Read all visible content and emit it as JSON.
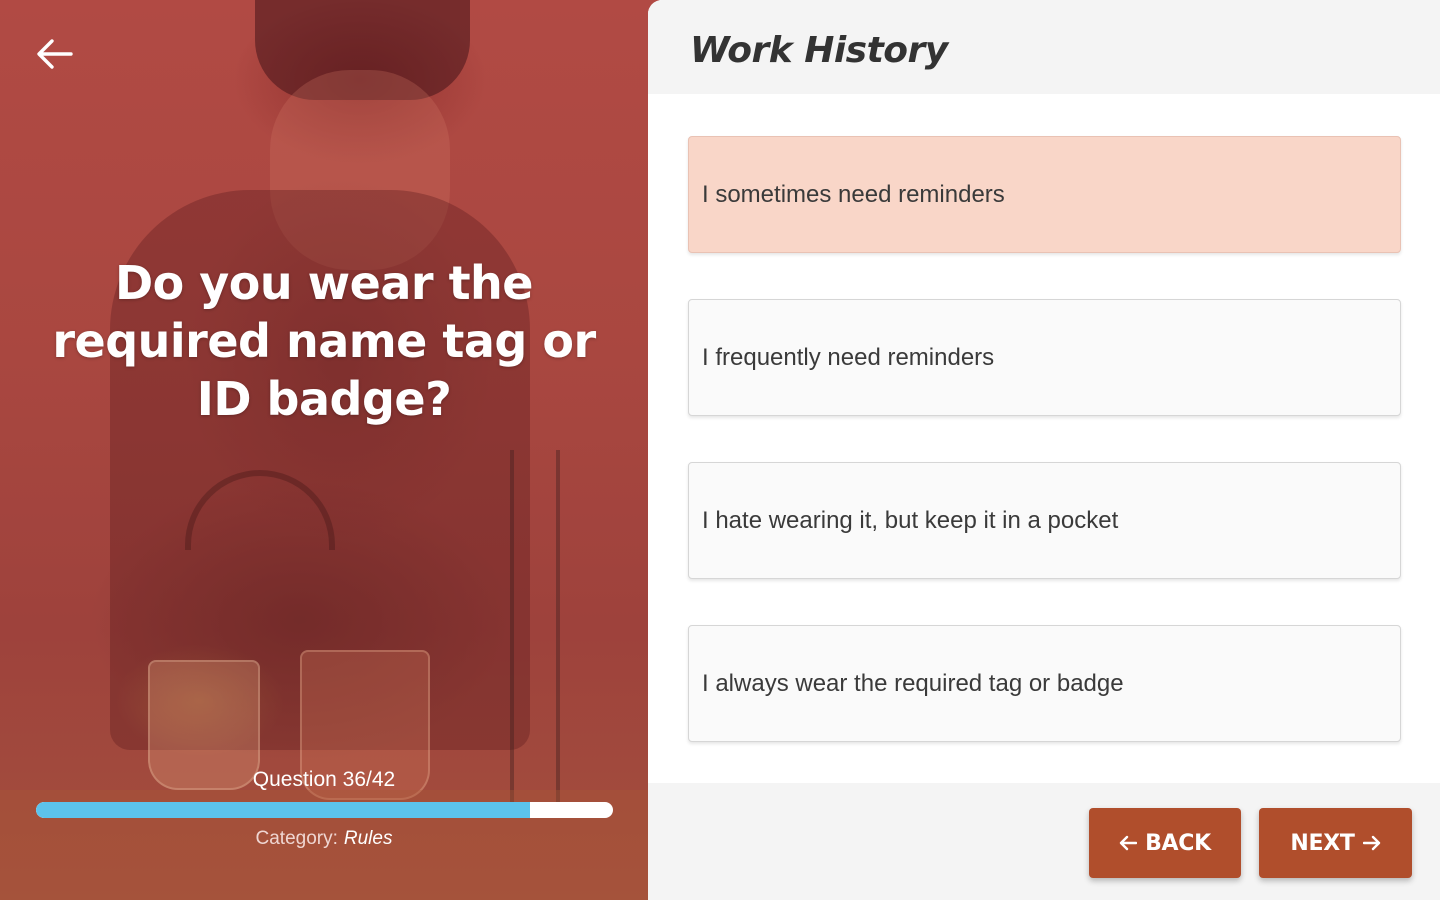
{
  "question_panel": {
    "question": "Do you wear the required name tag or ID badge?",
    "progress_label": "Question 36/42",
    "progress_fraction": 0.857,
    "category_label": "Category:",
    "category_value": "Rules",
    "back_icon": "arrow-left-icon"
  },
  "answer_panel": {
    "title": "Work History",
    "options": [
      {
        "label": "I sometimes need reminders",
        "selected": true
      },
      {
        "label": "I frequently need reminders",
        "selected": false
      },
      {
        "label": "I hate wearing it, but keep it in a pocket",
        "selected": false
      },
      {
        "label": "I always wear the required tag or badge",
        "selected": false
      }
    ],
    "back_button": {
      "label": "BACK",
      "icon": "arrow-left-icon"
    },
    "next_button": {
      "label": "NEXT",
      "icon": "arrow-right-icon"
    }
  },
  "colors": {
    "panel_tint": "#a94740",
    "selected_option": "#f9d6c8",
    "button": "#b04e2c",
    "progress_fill": "#5cc3ec"
  }
}
